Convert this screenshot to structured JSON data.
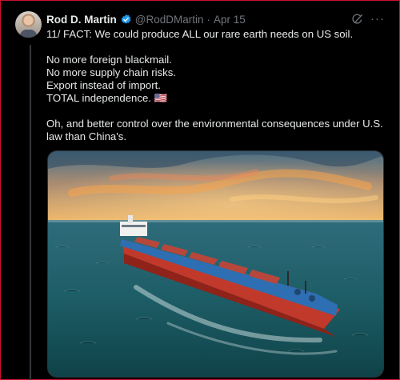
{
  "tweet": {
    "author_name": "Rod D. Martin",
    "handle": "@RodDMartin",
    "separator": "·",
    "date": "Apr 15",
    "more": "···",
    "lines": [
      "11/ FACT: We could produce ALL our rare earth needs on US soil.",
      "",
      "No more foreign blackmail.",
      "No more supply chain risks.",
      "Export instead of import.",
      "TOTAL independence. 🇺🇸",
      "",
      "Oh, and better control over the environmental consequences under U.S. law than China's."
    ]
  },
  "colors": {
    "background": "#000000",
    "text": "#e7e9ea",
    "muted": "#71767b",
    "verified": "#1d9bf0",
    "frame": "#c8102e"
  },
  "icons": [
    "verified-badge-icon",
    "grok-icon",
    "more-icon"
  ]
}
